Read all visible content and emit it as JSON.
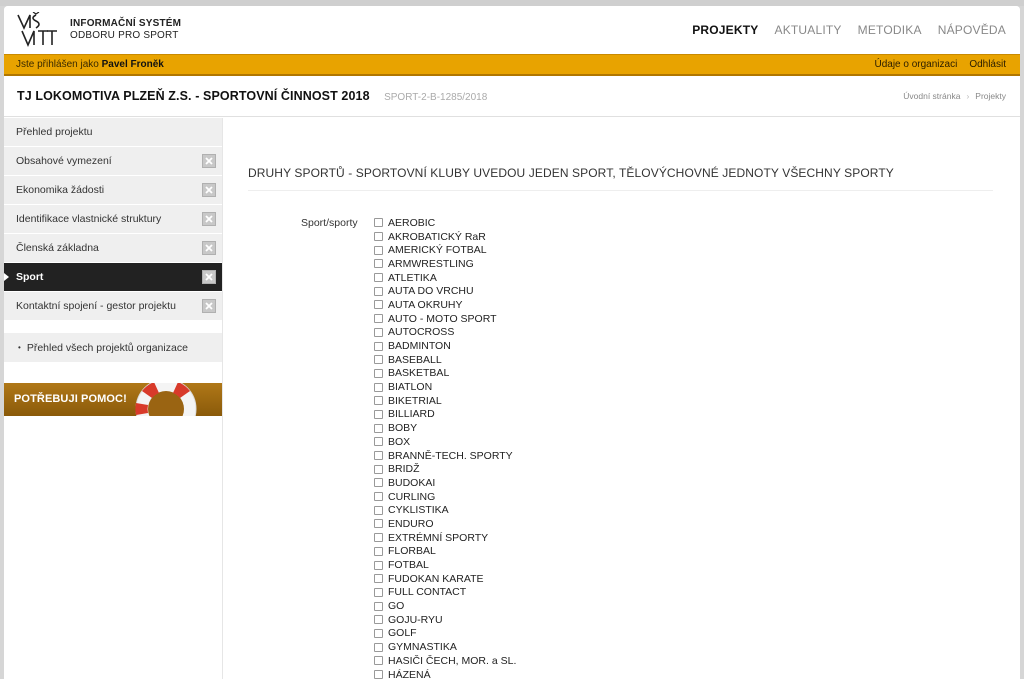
{
  "header": {
    "logo_line1": "INFORMAČNÍ SYSTÉM",
    "logo_line2": "ODBORU PRO SPORT",
    "nav": [
      {
        "label": "PROJEKTY",
        "active": true
      },
      {
        "label": "AKTUALITY",
        "active": false
      },
      {
        "label": "METODIKA",
        "active": false
      },
      {
        "label": "NÁPOVĚDA",
        "active": false
      }
    ]
  },
  "userbar": {
    "prefix": "Jste přihlášen jako",
    "user": "Pavel Froněk",
    "link_org": "Údaje o organizaci",
    "link_logout": "Odhlásit",
    "color": "#e8a300"
  },
  "project": {
    "title": "TJ LOKOMOTIVA PLZEŇ Z.S. - SPORTOVNÍ ČINNOST 2018",
    "code": "SPORT-2-B-1285/2018"
  },
  "breadcrumb": [
    "Úvodní stránka",
    "Projekty"
  ],
  "sidebar": {
    "items": [
      {
        "label": "Přehled projektu",
        "active": false,
        "removable": false
      },
      {
        "label": "Obsahové vymezení",
        "active": false,
        "removable": true
      },
      {
        "label": "Ekonomika žádosti",
        "active": false,
        "removable": true
      },
      {
        "label": "Identifikace vlastnické struktury",
        "active": false,
        "removable": true
      },
      {
        "label": "Členská základna",
        "active": false,
        "removable": true
      },
      {
        "label": "Sport",
        "active": true,
        "removable": true
      },
      {
        "label": "Kontaktní spojení - gestor projektu",
        "active": false,
        "removable": true
      }
    ],
    "all_projects": "Přehled všech projektů organizace",
    "help": "POTŘEBUJI POMOC!"
  },
  "main": {
    "section_title": "DRUHY SPORTŮ - SPORTOVNÍ KLUBY UVEDOU JEDEN SPORT, TĚLOVÝCHOVNÉ JEDNOTY VŠECHNY SPORTY",
    "field_label": "Sport/sporty",
    "sports": [
      "AEROBIC",
      "AKROBATICKÝ RaR",
      "AMERICKÝ FOTBAL",
      "ARMWRESTLING",
      "ATLETIKA",
      "AUTA DO VRCHU",
      "AUTA OKRUHY",
      "AUTO - MOTO SPORT",
      "AUTOCROSS",
      "BADMINTON",
      "BASEBALL",
      "BASKETBAL",
      "BIATLON",
      "BIKETRIAL",
      "BILLIARD",
      "BOBY",
      "BOX",
      "BRANNĚ-TECH. SPORTY",
      "BRIDŽ",
      "BUDOKAI",
      "CURLING",
      "CYKLISTIKA",
      "ENDURO",
      "EXTRÉMNÍ SPORTY",
      "FLORBAL",
      "FOTBAL",
      "FUDOKAN KARATE",
      "FULL CONTACT",
      "GO",
      "GOJU-RYU",
      "GOLF",
      "GYMNASTIKA",
      "HASIČI ČECH, MOR. a SL.",
      "HÁZENÁ"
    ]
  }
}
